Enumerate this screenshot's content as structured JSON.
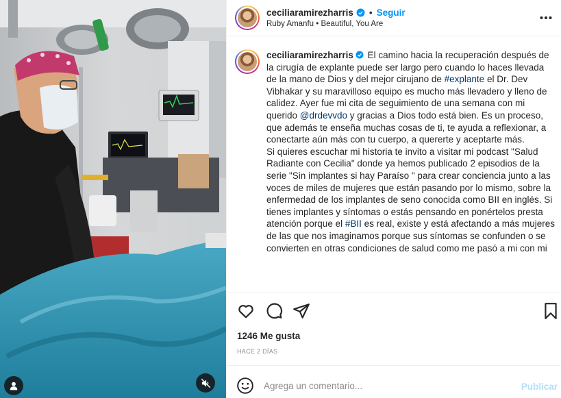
{
  "post": {
    "username": "ceciliaramirezharris",
    "follow_label": "Seguir",
    "separator": "•",
    "audio": "Ruby Amanfu • Beautiful, You Are"
  },
  "caption": {
    "username": "ceciliaramirezharris",
    "part1": "El camino hacia la recuperación después de la cirugía de explante puede ser largo pero cuando lo haces llevada de la mano de Dios y del mejor cirujano de ",
    "hashtag1": "#explante",
    "part2": " el Dr. Dev Vibhakar y su maravilloso equipo es mucho más llevadero y lleno de calidez. Ayer fue mi cita de seguimiento de una semana con mi querido ",
    "mention": "@drdevvdo",
    "part3": " y gracias a Dios todo está bien. Es un proceso, que además te enseña muchas cosas de ti, te ayuda a reflexionar, a conectarte aún más con tu cuerpo, a quererte y aceptarte más.",
    "part4": "Si quieres escuchar mi historia te invito a visitar mi podcast \"Salud Radiante con Cecilia\" donde ya hemos publicado 2 episodios de la serie \"Sin implantes si hay Paraíso \" para crear conciencia junto a las voces de miles de mujeres que están pasando por lo mismo, sobre la enfermedad de los implantes de seno conocida como BII en inglés. Si tienes implantes y síntomas o estás pensando en ponértelos presta atención porque el ",
    "hashtag2": "#BII",
    "part5": " es real, existe y está afectando a más mujeres de las que nos imaginamos porque sus síntomas se confunden o se convierten en otras condiciones de salud como me pasó a mi con mi"
  },
  "stats": {
    "likes": "1246 Me gusta",
    "time": "HACE 2 DÍAS"
  },
  "comment_box": {
    "placeholder": "Agrega un comentario...",
    "publish_label": "Publicar"
  },
  "icons": {
    "verified": "verified-badge-icon",
    "more": "more-options-icon",
    "like": "heart-icon",
    "comment": "comment-bubble-icon",
    "share": "paper-plane-icon",
    "save": "bookmark-icon",
    "emoji": "smiley-icon",
    "tag": "user-tag-icon",
    "mute": "muted-speaker-icon"
  },
  "colors": {
    "accent": "#0095f6",
    "link": "#00376b",
    "muted_text": "#8e8e8e",
    "publish_disabled": "#b2dffc"
  }
}
